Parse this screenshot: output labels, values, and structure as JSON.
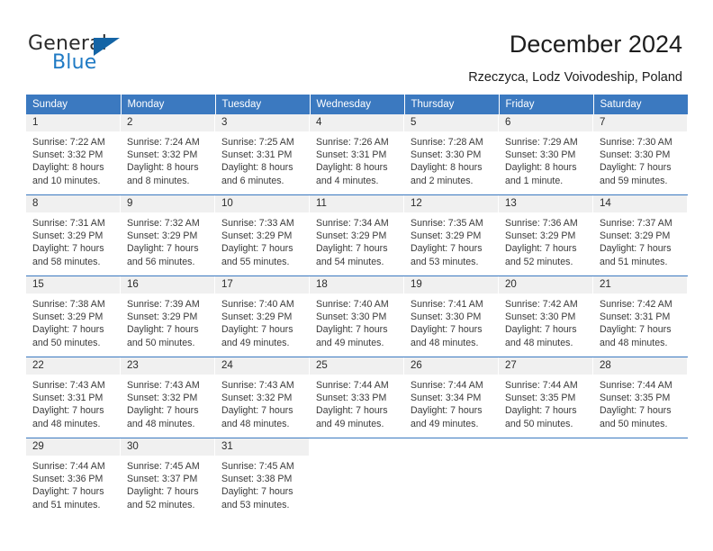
{
  "logo": {
    "word_top": "General",
    "word_bottom": "Blue",
    "accent_color": "#1464a5",
    "text_color": "#2b2b2b",
    "blue_text_color": "#1f7ac4",
    "triangle_icon": "triangle-icon"
  },
  "header": {
    "title": "December 2024",
    "subtitle": "Rzeczyca, Lodz Voivodeship, Poland"
  },
  "theme": {
    "header_bg": "#3b79c0",
    "header_text": "#ffffff",
    "daynum_bg": "#f0f0f0",
    "rule_color": "#3b79c0"
  },
  "weekday_headers": [
    "Sunday",
    "Monday",
    "Tuesday",
    "Wednesday",
    "Thursday",
    "Friday",
    "Saturday"
  ],
  "weeks": [
    [
      {
        "day": "1",
        "sunrise": "Sunrise: 7:22 AM",
        "sunset": "Sunset: 3:32 PM",
        "daylight_l1": "Daylight: 8 hours",
        "daylight_l2": "and 10 minutes."
      },
      {
        "day": "2",
        "sunrise": "Sunrise: 7:24 AM",
        "sunset": "Sunset: 3:32 PM",
        "daylight_l1": "Daylight: 8 hours",
        "daylight_l2": "and 8 minutes."
      },
      {
        "day": "3",
        "sunrise": "Sunrise: 7:25 AM",
        "sunset": "Sunset: 3:31 PM",
        "daylight_l1": "Daylight: 8 hours",
        "daylight_l2": "and 6 minutes."
      },
      {
        "day": "4",
        "sunrise": "Sunrise: 7:26 AM",
        "sunset": "Sunset: 3:31 PM",
        "daylight_l1": "Daylight: 8 hours",
        "daylight_l2": "and 4 minutes."
      },
      {
        "day": "5",
        "sunrise": "Sunrise: 7:28 AM",
        "sunset": "Sunset: 3:30 PM",
        "daylight_l1": "Daylight: 8 hours",
        "daylight_l2": "and 2 minutes."
      },
      {
        "day": "6",
        "sunrise": "Sunrise: 7:29 AM",
        "sunset": "Sunset: 3:30 PM",
        "daylight_l1": "Daylight: 8 hours",
        "daylight_l2": "and 1 minute."
      },
      {
        "day": "7",
        "sunrise": "Sunrise: 7:30 AM",
        "sunset": "Sunset: 3:30 PM",
        "daylight_l1": "Daylight: 7 hours",
        "daylight_l2": "and 59 minutes."
      }
    ],
    [
      {
        "day": "8",
        "sunrise": "Sunrise: 7:31 AM",
        "sunset": "Sunset: 3:29 PM",
        "daylight_l1": "Daylight: 7 hours",
        "daylight_l2": "and 58 minutes."
      },
      {
        "day": "9",
        "sunrise": "Sunrise: 7:32 AM",
        "sunset": "Sunset: 3:29 PM",
        "daylight_l1": "Daylight: 7 hours",
        "daylight_l2": "and 56 minutes."
      },
      {
        "day": "10",
        "sunrise": "Sunrise: 7:33 AM",
        "sunset": "Sunset: 3:29 PM",
        "daylight_l1": "Daylight: 7 hours",
        "daylight_l2": "and 55 minutes."
      },
      {
        "day": "11",
        "sunrise": "Sunrise: 7:34 AM",
        "sunset": "Sunset: 3:29 PM",
        "daylight_l1": "Daylight: 7 hours",
        "daylight_l2": "and 54 minutes."
      },
      {
        "day": "12",
        "sunrise": "Sunrise: 7:35 AM",
        "sunset": "Sunset: 3:29 PM",
        "daylight_l1": "Daylight: 7 hours",
        "daylight_l2": "and 53 minutes."
      },
      {
        "day": "13",
        "sunrise": "Sunrise: 7:36 AM",
        "sunset": "Sunset: 3:29 PM",
        "daylight_l1": "Daylight: 7 hours",
        "daylight_l2": "and 52 minutes."
      },
      {
        "day": "14",
        "sunrise": "Sunrise: 7:37 AM",
        "sunset": "Sunset: 3:29 PM",
        "daylight_l1": "Daylight: 7 hours",
        "daylight_l2": "and 51 minutes."
      }
    ],
    [
      {
        "day": "15",
        "sunrise": "Sunrise: 7:38 AM",
        "sunset": "Sunset: 3:29 PM",
        "daylight_l1": "Daylight: 7 hours",
        "daylight_l2": "and 50 minutes."
      },
      {
        "day": "16",
        "sunrise": "Sunrise: 7:39 AM",
        "sunset": "Sunset: 3:29 PM",
        "daylight_l1": "Daylight: 7 hours",
        "daylight_l2": "and 50 minutes."
      },
      {
        "day": "17",
        "sunrise": "Sunrise: 7:40 AM",
        "sunset": "Sunset: 3:29 PM",
        "daylight_l1": "Daylight: 7 hours",
        "daylight_l2": "and 49 minutes."
      },
      {
        "day": "18",
        "sunrise": "Sunrise: 7:40 AM",
        "sunset": "Sunset: 3:30 PM",
        "daylight_l1": "Daylight: 7 hours",
        "daylight_l2": "and 49 minutes."
      },
      {
        "day": "19",
        "sunrise": "Sunrise: 7:41 AM",
        "sunset": "Sunset: 3:30 PM",
        "daylight_l1": "Daylight: 7 hours",
        "daylight_l2": "and 48 minutes."
      },
      {
        "day": "20",
        "sunrise": "Sunrise: 7:42 AM",
        "sunset": "Sunset: 3:30 PM",
        "daylight_l1": "Daylight: 7 hours",
        "daylight_l2": "and 48 minutes."
      },
      {
        "day": "21",
        "sunrise": "Sunrise: 7:42 AM",
        "sunset": "Sunset: 3:31 PM",
        "daylight_l1": "Daylight: 7 hours",
        "daylight_l2": "and 48 minutes."
      }
    ],
    [
      {
        "day": "22",
        "sunrise": "Sunrise: 7:43 AM",
        "sunset": "Sunset: 3:31 PM",
        "daylight_l1": "Daylight: 7 hours",
        "daylight_l2": "and 48 minutes."
      },
      {
        "day": "23",
        "sunrise": "Sunrise: 7:43 AM",
        "sunset": "Sunset: 3:32 PM",
        "daylight_l1": "Daylight: 7 hours",
        "daylight_l2": "and 48 minutes."
      },
      {
        "day": "24",
        "sunrise": "Sunrise: 7:43 AM",
        "sunset": "Sunset: 3:32 PM",
        "daylight_l1": "Daylight: 7 hours",
        "daylight_l2": "and 48 minutes."
      },
      {
        "day": "25",
        "sunrise": "Sunrise: 7:44 AM",
        "sunset": "Sunset: 3:33 PM",
        "daylight_l1": "Daylight: 7 hours",
        "daylight_l2": "and 49 minutes."
      },
      {
        "day": "26",
        "sunrise": "Sunrise: 7:44 AM",
        "sunset": "Sunset: 3:34 PM",
        "daylight_l1": "Daylight: 7 hours",
        "daylight_l2": "and 49 minutes."
      },
      {
        "day": "27",
        "sunrise": "Sunrise: 7:44 AM",
        "sunset": "Sunset: 3:35 PM",
        "daylight_l1": "Daylight: 7 hours",
        "daylight_l2": "and 50 minutes."
      },
      {
        "day": "28",
        "sunrise": "Sunrise: 7:44 AM",
        "sunset": "Sunset: 3:35 PM",
        "daylight_l1": "Daylight: 7 hours",
        "daylight_l2": "and 50 minutes."
      }
    ],
    [
      {
        "day": "29",
        "sunrise": "Sunrise: 7:44 AM",
        "sunset": "Sunset: 3:36 PM",
        "daylight_l1": "Daylight: 7 hours",
        "daylight_l2": "and 51 minutes."
      },
      {
        "day": "30",
        "sunrise": "Sunrise: 7:45 AM",
        "sunset": "Sunset: 3:37 PM",
        "daylight_l1": "Daylight: 7 hours",
        "daylight_l2": "and 52 minutes."
      },
      {
        "day": "31",
        "sunrise": "Sunrise: 7:45 AM",
        "sunset": "Sunset: 3:38 PM",
        "daylight_l1": "Daylight: 7 hours",
        "daylight_l2": "and 53 minutes."
      },
      {
        "day": "",
        "sunrise": "",
        "sunset": "",
        "daylight_l1": "",
        "daylight_l2": ""
      },
      {
        "day": "",
        "sunrise": "",
        "sunset": "",
        "daylight_l1": "",
        "daylight_l2": ""
      },
      {
        "day": "",
        "sunrise": "",
        "sunset": "",
        "daylight_l1": "",
        "daylight_l2": ""
      },
      {
        "day": "",
        "sunrise": "",
        "sunset": "",
        "daylight_l1": "",
        "daylight_l2": ""
      }
    ]
  ]
}
